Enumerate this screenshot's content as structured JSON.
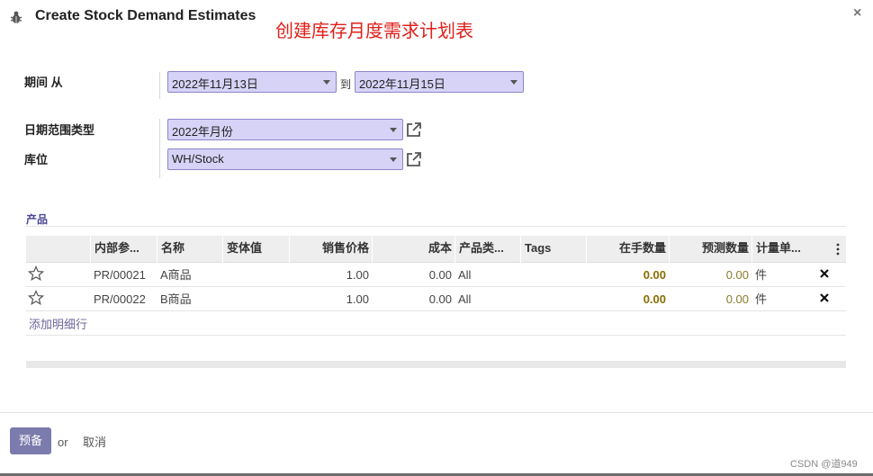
{
  "header": {
    "title": "Create Stock Demand Estimates",
    "annotation": "创建库存月度需求计划表",
    "close": "×"
  },
  "form": {
    "period_label": "期间 从",
    "date_from": "2022年11月13日",
    "to_label": "到",
    "date_to": "2022年11月15日",
    "date_range_type_label": "日期范围类型",
    "date_range_type": "2022年月份",
    "location_label": "库位",
    "location": "WH/Stock"
  },
  "products": {
    "section_title": "产品",
    "columns": [
      "内部参...",
      "名称",
      "变体值",
      "销售价格",
      "成本",
      "产品类...",
      "Tags",
      "在手数量",
      "预测数量",
      "计量单..."
    ],
    "rows": [
      {
        "ref": "PR/00021",
        "name": "A商品",
        "variant": "",
        "price": "1.00",
        "cost": "0.00",
        "category": "All",
        "tags": "",
        "on_hand": "0.00",
        "forecast": "0.00",
        "uom": "件"
      },
      {
        "ref": "PR/00022",
        "name": "B商品",
        "variant": "",
        "price": "1.00",
        "cost": "0.00",
        "category": "All",
        "tags": "",
        "on_hand": "0.00",
        "forecast": "0.00",
        "uom": "件"
      }
    ],
    "add_line": "添加明细行"
  },
  "footer": {
    "prepare_label": "预备",
    "or_label": "or",
    "cancel_label": "取消"
  },
  "watermark": "CSDN @道949",
  "colors": {
    "accent": "#7c7bad",
    "select_bg": "#d6d3f7",
    "annotation": "#e0201a",
    "quantity": "#8a6d00"
  }
}
